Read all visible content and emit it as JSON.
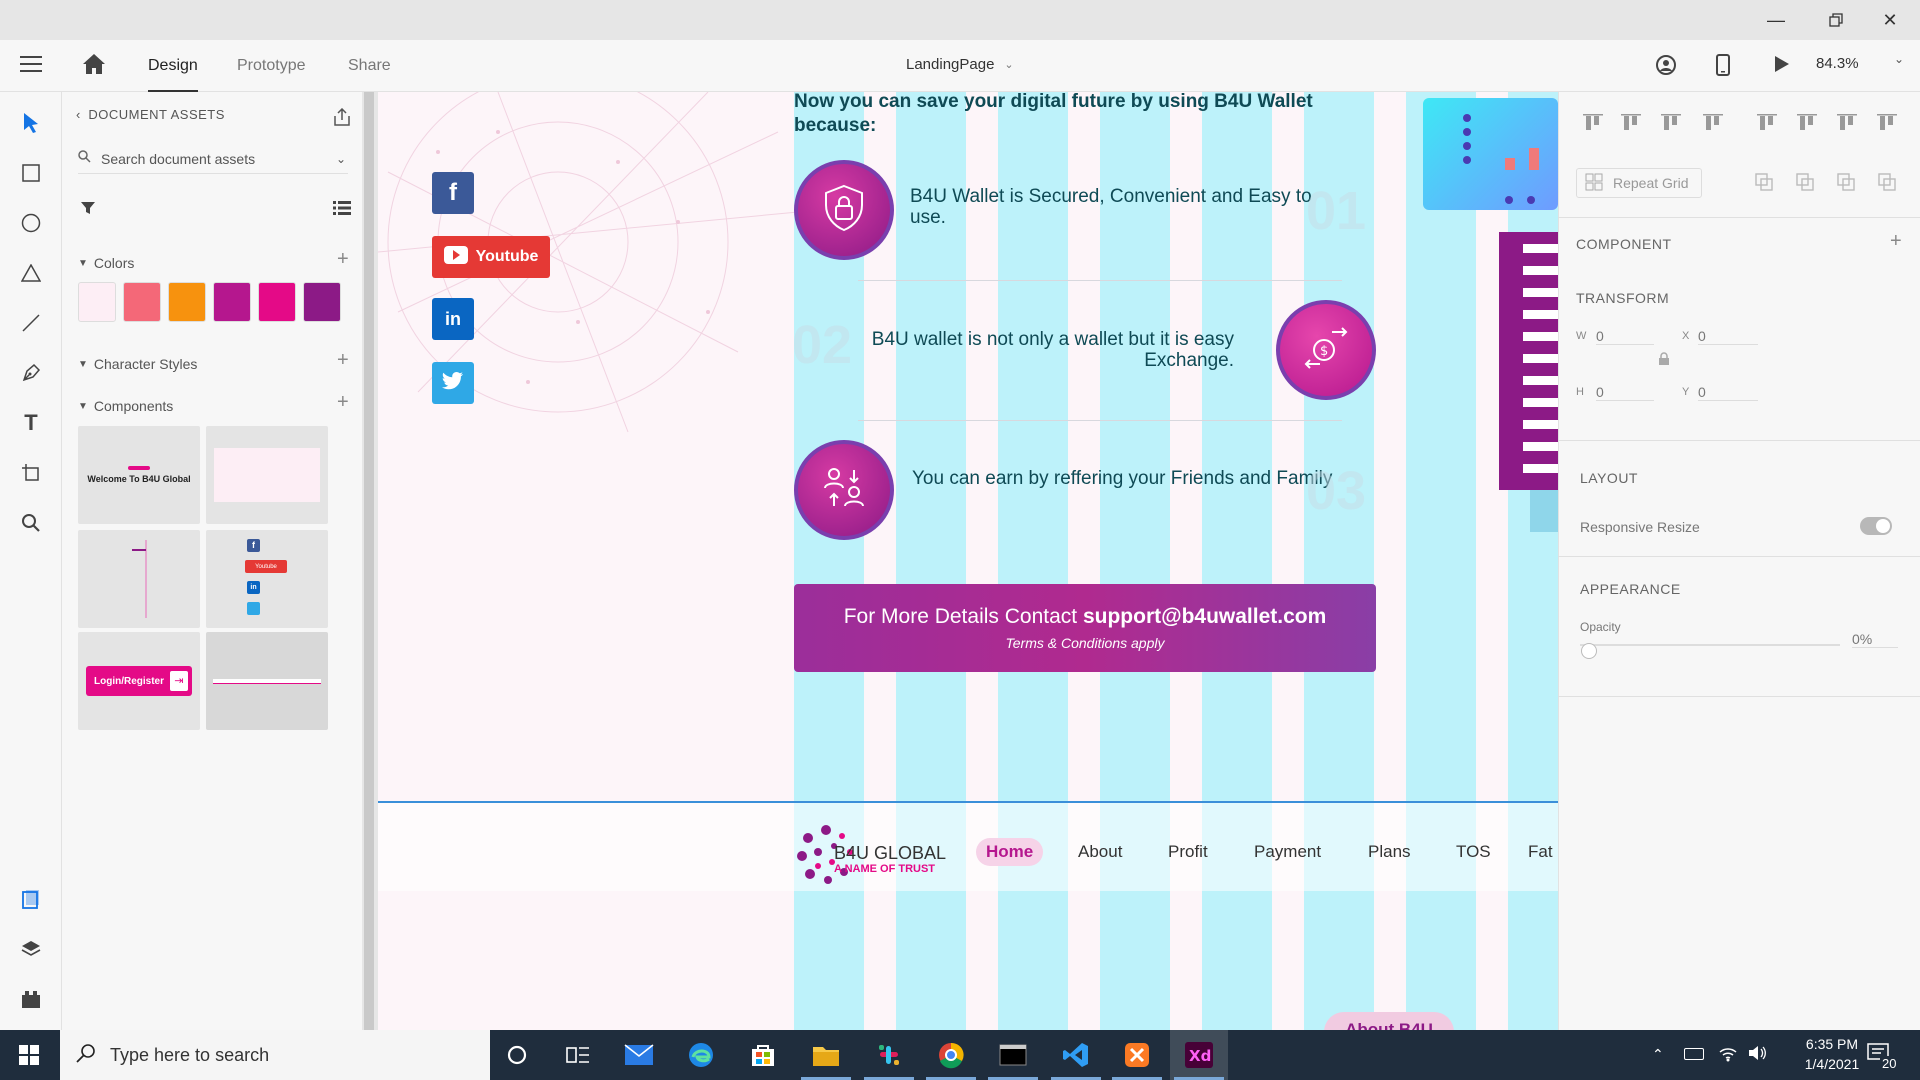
{
  "app": {
    "tabs": {
      "design": "Design",
      "prototype": "Prototype",
      "share": "Share"
    },
    "document_title": "LandingPage",
    "zoom": "84.3%"
  },
  "assets_panel": {
    "header": "DOCUMENT ASSETS",
    "search_placeholder": "Search document assets",
    "colors_label": "Colors",
    "colors": [
      "#fdeef5",
      "#f46878",
      "#f7920e",
      "#b5178e",
      "#e40a87",
      "#8c1a86"
    ],
    "character_styles_label": "Character Styles",
    "components_label": "Components",
    "component_thumbs": {
      "welcome": "Welcome To B4U Global",
      "youtube": "Youtube",
      "login": "Login/Register"
    }
  },
  "canvas": {
    "heading": "Now you can save your digital future by using B4U Wallet because:",
    "social": {
      "youtube": "Youtube"
    },
    "features": [
      {
        "text": "B4U Wallet is Secured, Convenient and Easy to use.",
        "number": "01"
      },
      {
        "text": "B4U wallet is not only a wallet but it is easy Exchange.",
        "number": "02"
      },
      {
        "text": "You can earn by reffering your Friends and Family",
        "number": "03"
      }
    ],
    "contact": {
      "prefix": "For More Details Contact ",
      "email": "support@b4uwallet.com",
      "terms": "Terms & Conditions apply"
    },
    "brand": {
      "name": "B4U GLOBAL",
      "tagline": "A NAME OF TRUST"
    },
    "nav": [
      "Home",
      "About",
      "Profit",
      "Payment",
      "Plans",
      "TOS",
      "Fat"
    ],
    "bottom_peek": "About B4U"
  },
  "props_panel": {
    "repeat_grid": "Repeat Grid",
    "component": "COMPONENT",
    "transform": "TRANSFORM",
    "w_label": "W",
    "w": "0",
    "x_label": "X",
    "x": "0",
    "h_label": "H",
    "h": "0",
    "y_label": "Y",
    "y": "0",
    "layout": "LAYOUT",
    "responsive_resize": "Responsive Resize",
    "appearance": "APPEARANCE",
    "opacity_label": "Opacity",
    "opacity_value": "0%"
  },
  "taskbar": {
    "search_placeholder": "Type here to search",
    "time": "6:35 PM",
    "date": "1/4/2021",
    "notification_count": "20"
  },
  "colors": {
    "accent": "#b5178e",
    "pink": "#e40a87",
    "purple": "#8c1a86",
    "cyan_grid": "#96f0fa"
  }
}
